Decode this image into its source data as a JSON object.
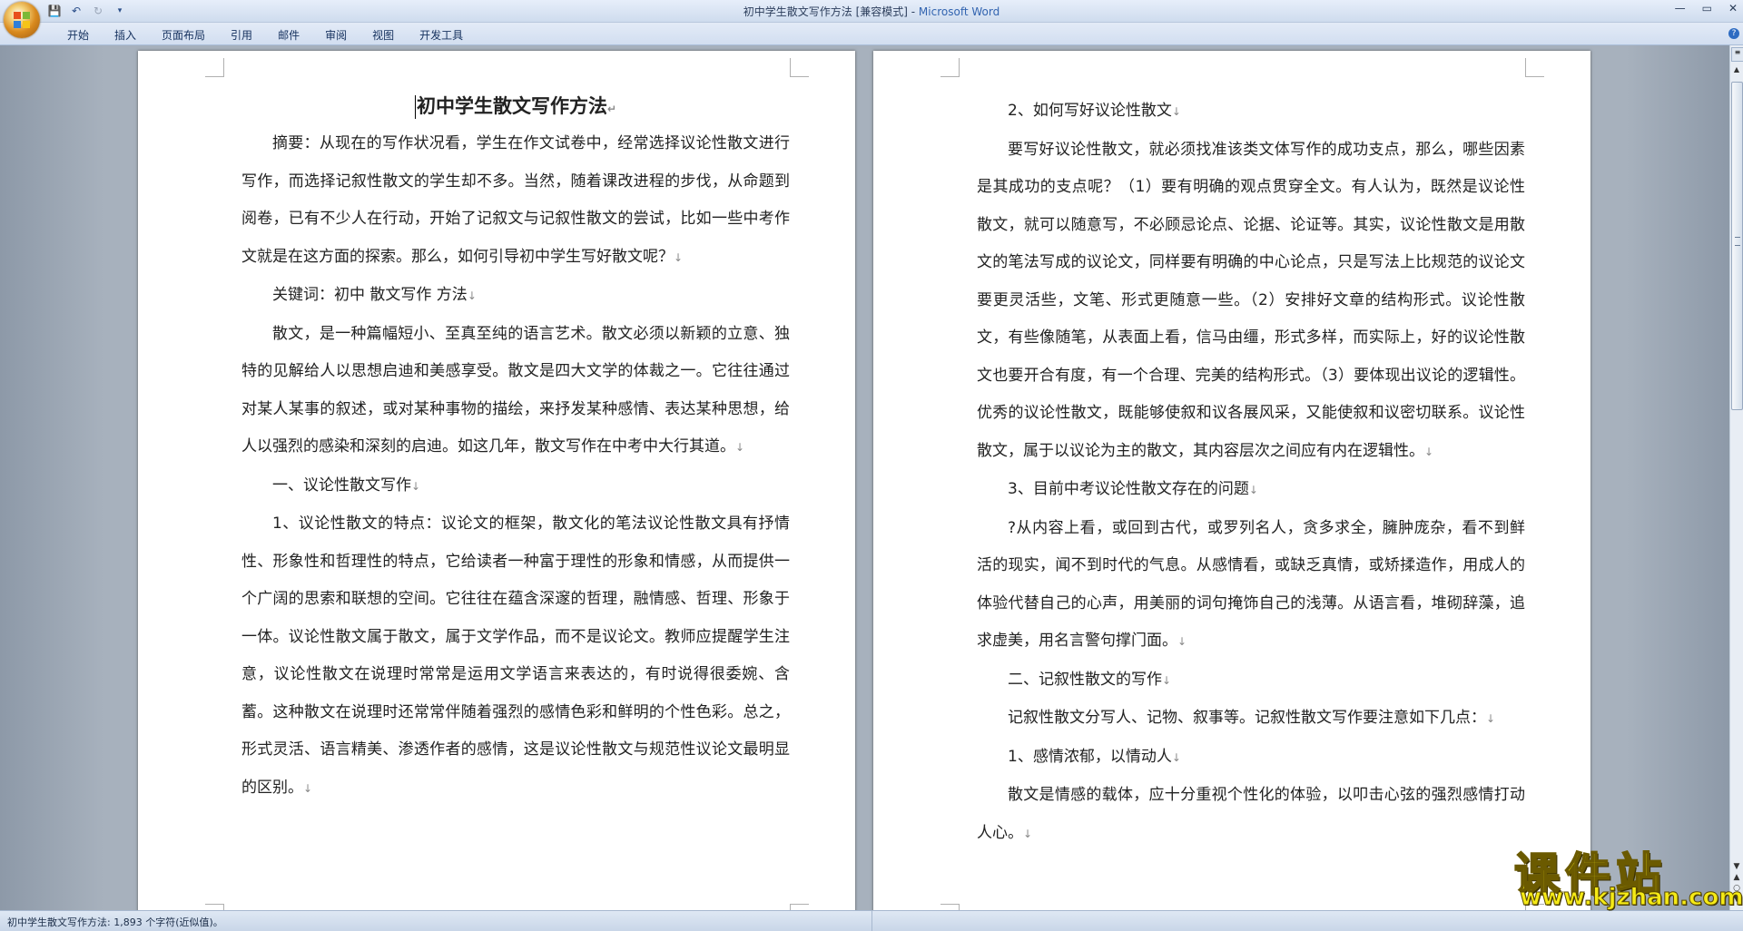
{
  "window": {
    "title_doc": "初中学生散文写作方法 [兼容模式] - ",
    "title_app": "Microsoft Word",
    "controls": [
      "—",
      "▭",
      "✕"
    ]
  },
  "quick_access": {
    "save_icon": "save-icon",
    "undo_icon": "undo-icon",
    "redo_icon": "redo-icon",
    "customize_icon": "customize-qat-icon"
  },
  "ribbon": {
    "tabs": [
      "开始",
      "插入",
      "页面布局",
      "引用",
      "邮件",
      "审阅",
      "视图",
      "开发工具"
    ]
  },
  "document": {
    "left_page": {
      "title": "初中学生散文写作方法",
      "paragraphs": [
        "摘要：从现在的写作状况看，学生在作文试卷中，经常选择议论性散文进行写作，而选择记叙性散文的学生却不多。当然，随着课改进程的步伐，从命题到阅卷，已有不少人在行动，开始了记叙文与记叙性散文的尝试，比如一些中考作文就是在这方面的探索。那么，如何引导初中学生写好散文呢？",
        "关键词：初中 散文写作 方法",
        "散文，是一种篇幅短小、至真至纯的语言艺术。散文必须以新颖的立意、独特的见解给人以思想启迪和美感享受。散文是四大文学的体裁之一。它往往通过对某人某事的叙述，或对某种事物的描绘，来抒发某种感情、表达某种思想，给人以强烈的感染和深刻的启迪。如这几年，散文写作在中考中大行其道。",
        "一、议论性散文写作",
        "1、议论性散文的特点：议论文的框架，散文化的笔法议论性散文具有抒情性、形象性和哲理性的特点，它给读者一种富于理性的形象和情感，从而提供一个广阔的思索和联想的空间。它往往在蕴含深邃的哲理，融情感、哲理、形象于一体。议论性散文属于散文，属于文学作品，而不是议论文。教师应提醒学生注意，议论性散文在说理时常常是运用文学语言来表达的，有时说得很委婉、含蓄。这种散文在说理时还常常伴随着强烈的感情色彩和鲜明的个性色彩。总之，形式灵活、语言精美、渗透作者的感情，这是议论性散文与规范性议论文最明显的区别。"
      ]
    },
    "right_page": {
      "paragraphs": [
        "2、如何写好议论性散文",
        "要写好议论性散文，就必须找准该类文体写作的成功支点，那么，哪些因素是其成功的支点呢？（1）要有明确的观点贯穿全文。有人认为，既然是议论性散文，就可以随意写，不必顾忌论点、论据、论证等。其实，议论性散文是用散文的笔法写成的议论文，同样要有明确的中心论点，只是写法上比规范的议论文要更灵活些，文笔、形式更随意一些。（2）安排好文章的结构形式。议论性散文，有些像随笔，从表面上看，信马由缰，形式多样，而实际上，好的议论性散文也要开合有度，有一个合理、完美的结构形式。（3）要体现出议论的逻辑性。优秀的议论性散文，既能够使叙和议各展风采，又能使叙和议密切联系。议论性散文，属于以议论为主的散文，其内容层次之间应有内在逻辑性。",
        "3、目前中考议论性散文存在的问题",
        "?从内容上看，或回到古代，或罗列名人，贪多求全，臃肿庞杂，看不到鲜活的现实，闻不到时代的气息。从感情看，或缺乏真情，或矫揉造作，用成人的体验代替自己的心声，用美丽的词句掩饰自己的浅薄。从语言看，堆砌辞藻，追求虚美，用名言警句撑门面。",
        "二、记叙性散文的写作",
        "记叙性散文分写人、记物、叙事等。记叙性散文写作要注意如下几点：",
        "1、感情浓郁，以情动人",
        "散文是情感的载体，应十分重视个性化的体验，以叩击心弦的强烈感情打动人心。"
      ]
    }
  },
  "status_bar": {
    "text": "初中学生散文写作方法: 1,893 个字符(近似值)。"
  },
  "scrollbar": {
    "ruler_icon": "ruler-toggle-icon",
    "bottom_buttons": [
      "▲",
      "○",
      "▼"
    ]
  },
  "watermark": {
    "brand": "课件站",
    "url": "www.kjzhan.com"
  },
  "para_mark": "↓"
}
